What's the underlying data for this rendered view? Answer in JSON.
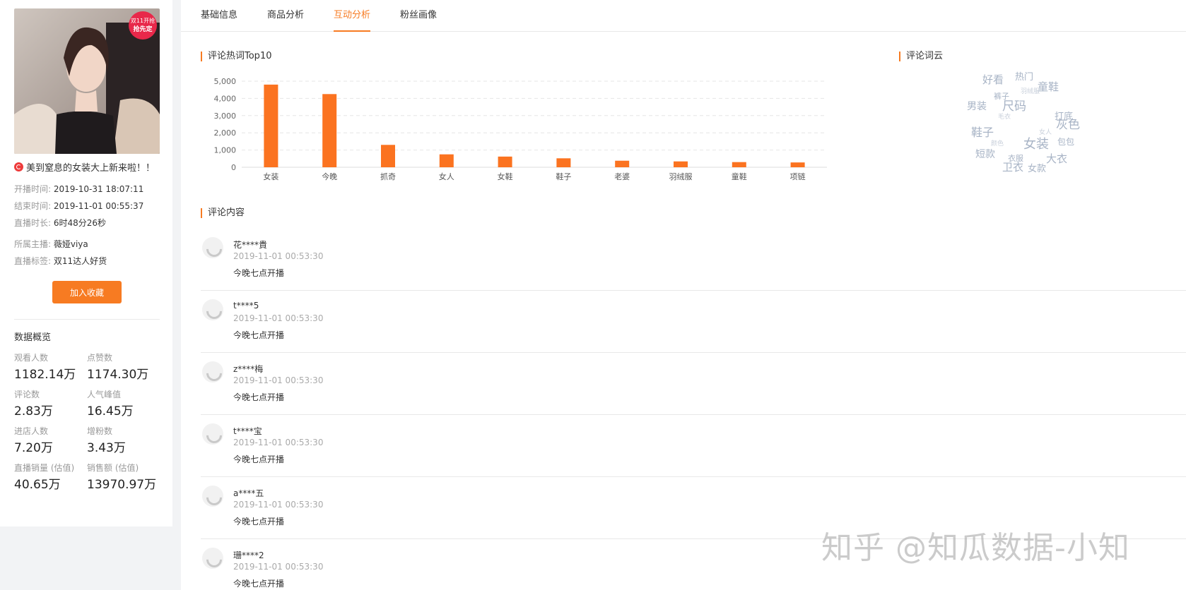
{
  "stream": {
    "badge_line1": "双11开抢",
    "badge_line2": "抢先定",
    "title": "美到窒息的女装大上新来啦！！",
    "start_label": "开播时间:",
    "start_value": "2019-10-31 18:07:11",
    "end_label": "结束时间:",
    "end_value": "2019-11-01 00:55:37",
    "duration_label": "直播时长:",
    "duration_value": "6时48分26秒",
    "host_label": "所属主播:",
    "host_value": "薇娅viya",
    "tag_label": "直播标签:",
    "tag_value": "双11达人好货",
    "collect_button": "加入收藏"
  },
  "overview": {
    "title": "数据概览",
    "stats": [
      {
        "label": "观看人数",
        "value": "1182.14万"
      },
      {
        "label": "点赞数",
        "value": "1174.30万"
      },
      {
        "label": "评论数",
        "value": "2.83万"
      },
      {
        "label": "人气峰值",
        "value": "16.45万"
      },
      {
        "label": "进店人数",
        "value": "7.20万"
      },
      {
        "label": "增粉数",
        "value": "3.43万"
      },
      {
        "label": "直播销量 (估值)",
        "value": "40.65万"
      },
      {
        "label": "销售额 (估值)",
        "value": "13970.97万"
      }
    ]
  },
  "tabs": [
    "基础信息",
    "商品分析",
    "互动分析",
    "粉丝画像"
  ],
  "active_tab": 2,
  "sections": {
    "hotwords": "评论热词Top10",
    "wordcloud": "评论词云",
    "comments": "评论内容"
  },
  "chart_data": {
    "type": "bar",
    "title": "评论热词Top10",
    "categories": [
      "女装",
      "今晚",
      "抓奇",
      "女人",
      "女鞋",
      "鞋子",
      "老婆",
      "羽绒服",
      "童鞋",
      "项链"
    ],
    "values": [
      4800,
      4250,
      1300,
      750,
      620,
      520,
      380,
      340,
      300,
      280
    ],
    "ylim": [
      0,
      5000
    ],
    "yticks": [
      "0",
      "1,000",
      "2,000",
      "3,000",
      "4,000",
      "5,000"
    ],
    "grid": true,
    "bar_color": "#fb7320"
  },
  "wordcloud_words": [
    {
      "text": "好看",
      "size": 15
    },
    {
      "text": "热门",
      "size": 13
    },
    {
      "text": "童鞋",
      "size": 15
    },
    {
      "text": "裤子",
      "size": 11
    },
    {
      "text": "尺码",
      "size": 17
    },
    {
      "text": "男装",
      "size": 14
    },
    {
      "text": "打底",
      "size": 13
    },
    {
      "text": "灰色",
      "size": 17
    },
    {
      "text": "鞋子",
      "size": 16
    },
    {
      "text": "女装",
      "size": 18
    },
    {
      "text": "包包",
      "size": 12
    },
    {
      "text": "短款",
      "size": 14
    },
    {
      "text": "大衣",
      "size": 15
    },
    {
      "text": "卫衣",
      "size": 15
    },
    {
      "text": "衣服",
      "size": 11
    },
    {
      "text": "女款",
      "size": 13
    },
    {
      "text": "毛衣",
      "size": 9
    },
    {
      "text": "羽绒服",
      "size": 9
    },
    {
      "text": "颜色",
      "size": 9
    },
    {
      "text": "女人",
      "size": 9
    }
  ],
  "comments": [
    {
      "user": "花****貴",
      "time": "2019-11-01 00:53:30",
      "text": "今晚七点开播"
    },
    {
      "user": "t****5",
      "time": "2019-11-01 00:53:30",
      "text": "今晚七点开播"
    },
    {
      "user": "z****梅",
      "time": "2019-11-01 00:53:30",
      "text": "今晚七点开播"
    },
    {
      "user": "t****宝",
      "time": "2019-11-01 00:53:30",
      "text": "今晚七点开播"
    },
    {
      "user": "a****五",
      "time": "2019-11-01 00:53:30",
      "text": "今晚七点开播"
    },
    {
      "user": "珊****2",
      "time": "2019-11-01 00:53:30",
      "text": "今晚七点开播"
    }
  ],
  "watermark": "知乎 @知瓜数据-小知",
  "colors": {
    "accent": "#f77b22",
    "cloud_text": "#a7b3c5"
  }
}
